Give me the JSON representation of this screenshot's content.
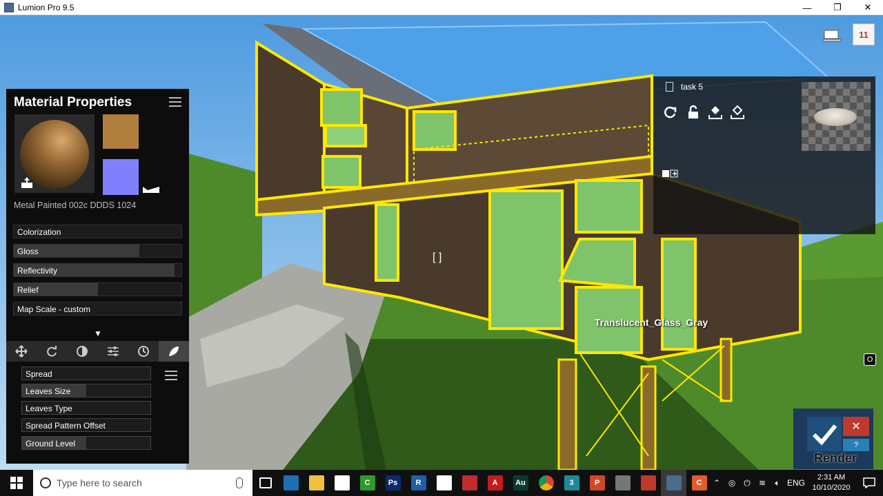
{
  "window": {
    "title": "Lumion Pro 9.5",
    "minimize": "—",
    "restore": "❐",
    "close": "✕"
  },
  "material_panel": {
    "title": "Material Properties",
    "material_name": "Metal Painted 002c DDDS 1024",
    "sliders": [
      {
        "label": "Colorization",
        "level": 0.0
      },
      {
        "label": "Gloss",
        "level": 0.75
      },
      {
        "label": "Reflectivity",
        "level": 0.96
      },
      {
        "label": "Relief",
        "level": 0.5
      },
      {
        "label": "Map Scale - custom",
        "level": 0.0
      }
    ],
    "expand_arrow": "▼",
    "tabs": [
      "move-icon",
      "rotate-icon",
      "weathering-icon",
      "settings-icon",
      "clock-icon",
      "leaves-icon"
    ],
    "sub_sliders": [
      {
        "label": "Spread",
        "level": 0.0
      },
      {
        "label": "Leaves Size",
        "level": 0.5
      },
      {
        "label": "Leaves Type",
        "level": 0.0
      },
      {
        "label": "Spread Pattern Offset",
        "level": 0.0
      },
      {
        "label": "Ground Level",
        "level": 0.5
      }
    ]
  },
  "task_panel": {
    "name": "task 5"
  },
  "viewport": {
    "hover_label": "Translucent_Glass_Gray",
    "target_icon": "[  ]",
    "o_button": "O",
    "top_right_badge": "11"
  },
  "render_panel": {
    "cancel": "✕",
    "help": "?",
    "label": "Render"
  },
  "taskbar": {
    "search_placeholder": "Type here to search",
    "apps": [
      {
        "name": "task-view",
        "label": "",
        "color": "#101010"
      },
      {
        "name": "sketchup",
        "label": "",
        "color": "#1a6fb5"
      },
      {
        "name": "file-explorer",
        "label": "",
        "color": "#f0c040"
      },
      {
        "name": "notepad",
        "label": "",
        "color": "#ffffff"
      },
      {
        "name": "camtasia",
        "label": "C",
        "color": "#2d9a2d"
      },
      {
        "name": "photoshop",
        "label": "Ps",
        "color": "#0a2a6a"
      },
      {
        "name": "revit",
        "label": "R",
        "color": "#1e5fa8"
      },
      {
        "name": "store",
        "label": "",
        "color": "#ffffff"
      },
      {
        "name": "sketchup-red",
        "label": "",
        "color": "#c22c2c"
      },
      {
        "name": "autocad",
        "label": "A",
        "color": "#c21c1c"
      },
      {
        "name": "audition",
        "label": "Au",
        "color": "#0a3a2e"
      },
      {
        "name": "chrome",
        "label": "",
        "color": "#e8a02b"
      },
      {
        "name": "3dsmax",
        "label": "3",
        "color": "#1e8a9a"
      },
      {
        "name": "powerpoint",
        "label": "P",
        "color": "#d24726"
      },
      {
        "name": "lumion-planet",
        "label": "",
        "color": "#777777"
      },
      {
        "name": "davinci",
        "label": "",
        "color": "#c0392b"
      },
      {
        "name": "lumion",
        "label": "",
        "color": "#4a6b8c"
      },
      {
        "name": "camtasia-rec",
        "label": "C",
        "color": "#e25b2a"
      }
    ],
    "tray_lang": "ENG",
    "time": "2:31 AM",
    "date": "10/10/2020"
  },
  "colors": {
    "selection_outline": "#ffe800",
    "wall_wood": "#4a3a2c",
    "glass": "#7fc46a",
    "sky": "#5ea7e8",
    "grass": "#4f8a2a"
  }
}
